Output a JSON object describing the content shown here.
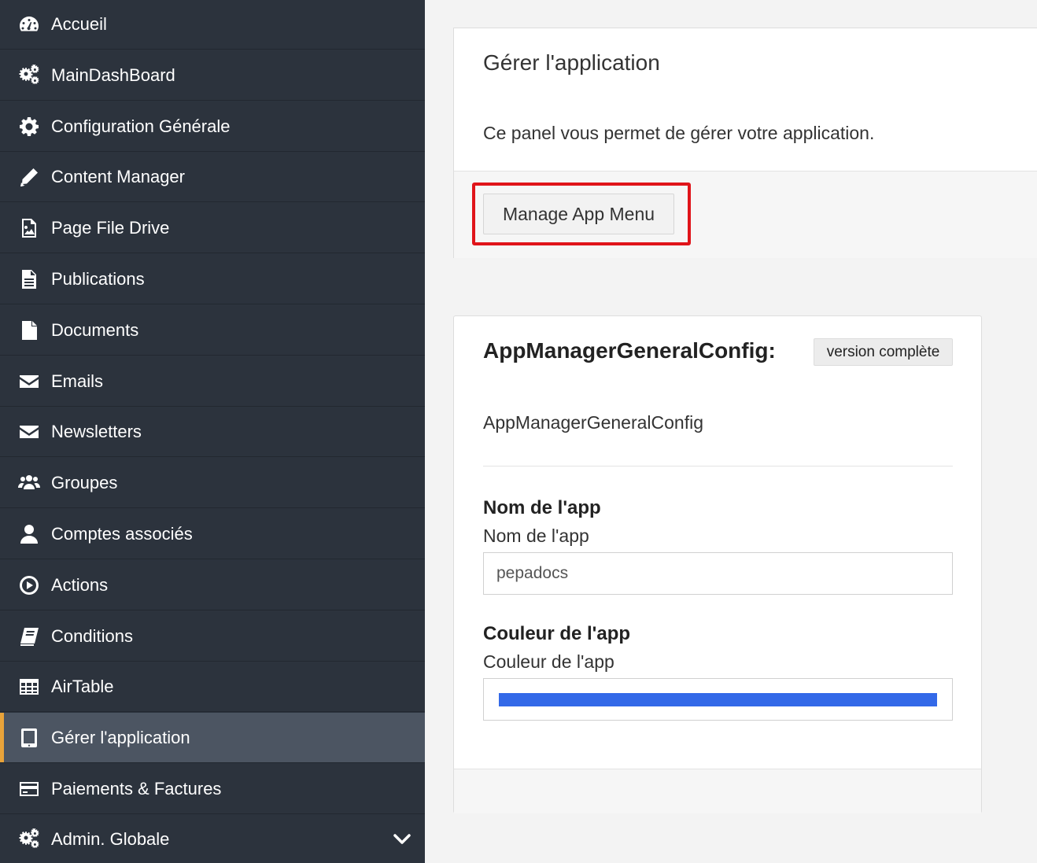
{
  "sidebar": {
    "items": [
      {
        "label": "Accueil",
        "icon": "dashboard-icon"
      },
      {
        "label": "MainDashBoard",
        "icon": "gears-icon"
      },
      {
        "label": "Configuration Générale",
        "icon": "gear-icon"
      },
      {
        "label": "Content Manager",
        "icon": "pencil-icon"
      },
      {
        "label": "Page File Drive",
        "icon": "image-file-icon"
      },
      {
        "label": "Publications",
        "icon": "text-file-icon"
      },
      {
        "label": "Documents",
        "icon": "file-icon"
      },
      {
        "label": "Emails",
        "icon": "envelope-icon"
      },
      {
        "label": "Newsletters",
        "icon": "envelope-icon"
      },
      {
        "label": "Groupes",
        "icon": "users-icon"
      },
      {
        "label": "Comptes associés",
        "icon": "user-icon"
      },
      {
        "label": "Actions",
        "icon": "play-circle-icon"
      },
      {
        "label": "Conditions",
        "icon": "book-icon"
      },
      {
        "label": "AirTable",
        "icon": "table-icon"
      },
      {
        "label": "Gérer l'application",
        "icon": "tablet-icon",
        "active": true
      },
      {
        "label": "Paiements & Factures",
        "icon": "credit-card-icon"
      },
      {
        "label": "Admin. Globale",
        "icon": "gears-icon",
        "expandable": true
      }
    ],
    "colors": {
      "background": "#2c333d",
      "active_bg": "#4c5562",
      "active_accent": "#e8a33a"
    }
  },
  "manage_panel": {
    "title": "Gérer l'application",
    "description": "Ce panel vous permet de gérer votre application.",
    "button_label": "Manage App Menu",
    "highlight_color": "#e0141a"
  },
  "config_panel": {
    "title": "AppManagerGeneralConfig:",
    "badge": "version complète",
    "subtitle": "AppManagerGeneralConfig",
    "fields": {
      "app_name": {
        "label": "Nom de l'app",
        "help": "Nom de l'app",
        "value": "pepadocs"
      },
      "app_color": {
        "label": "Couleur de l'app",
        "help": "Couleur de l'app",
        "value": "#3369e8"
      }
    }
  }
}
